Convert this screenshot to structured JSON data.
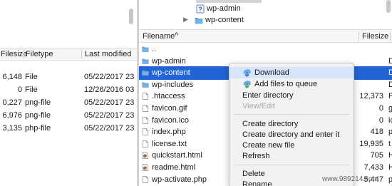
{
  "left_pane": {
    "columns": {
      "filesize": "Filesize",
      "filetype": "Filetype",
      "last_modified": "Last modified"
    },
    "rows": [
      {
        "size": "6,148",
        "type": "File",
        "date": "05/22/2017 23"
      },
      {
        "size": "0",
        "type": "File",
        "date": "12/26/2016 03"
      },
      {
        "size": "0,227",
        "type": "png-file",
        "date": "05/22/2017 23"
      },
      {
        "size": "6,976",
        "type": "png-file",
        "date": "05/22/2017 23"
      },
      {
        "size": "3,135",
        "type": "php-file",
        "date": "05/22/2017 23"
      }
    ]
  },
  "right_pane": {
    "tree": [
      {
        "label": "wp-admin",
        "icon": "question-folder-icon"
      },
      {
        "label": "wp-content",
        "icon": "folder-icon"
      }
    ],
    "columns": {
      "filename": "Filename",
      "filesize": "Filesize",
      "sort_indicator": "^"
    },
    "rows": [
      {
        "name": "..",
        "size": "",
        "type": "",
        "icon": "folder-icon"
      },
      {
        "name": "wp-admin",
        "size": "",
        "type": "D",
        "icon": "folder-icon"
      },
      {
        "name": "wp-content",
        "size": "",
        "type": "D",
        "icon": "folder-icon"
      },
      {
        "name": "wp-includes",
        "size": "",
        "type": "D",
        "icon": "folder-icon"
      },
      {
        "name": ".htaccess",
        "size": "12,373",
        "type": "F",
        "icon": "file-icon"
      },
      {
        "name": "favicon.gif",
        "size": "0",
        "type": "g",
        "icon": "file-icon"
      },
      {
        "name": "favicon.ico",
        "size": "0",
        "type": "ic",
        "icon": "file-icon"
      },
      {
        "name": "index.php",
        "size": "418",
        "type": "p",
        "icon": "file-icon"
      },
      {
        "name": "license.txt",
        "size": "19,935",
        "type": "t",
        "icon": "file-icon"
      },
      {
        "name": "quickstart.html",
        "size": "705",
        "type": "H",
        "icon": "chrome-file-icon"
      },
      {
        "name": "readme.html",
        "size": "7,433",
        "type": "H",
        "icon": "chrome-file-icon"
      },
      {
        "name": "wp-activate.php",
        "size": "5,447",
        "type": "p",
        "icon": "file-icon"
      }
    ],
    "selected_row": "wp-content"
  },
  "context_menu": {
    "download": "Download",
    "add_to_queue": "Add files to queue",
    "enter_directory": "Enter directory",
    "view_edit": "View/Edit",
    "create_directory": "Create directory",
    "create_directory_enter": "Create directory and enter it",
    "create_new_file": "Create new file",
    "refresh": "Refresh",
    "delete": "Delete",
    "rename": "Rename"
  },
  "colors": {
    "selection": "#2164d8",
    "folder": "#5b9bd5",
    "menu_highlight": "#d7e5fb"
  },
  "watermark": "www.989214.com"
}
